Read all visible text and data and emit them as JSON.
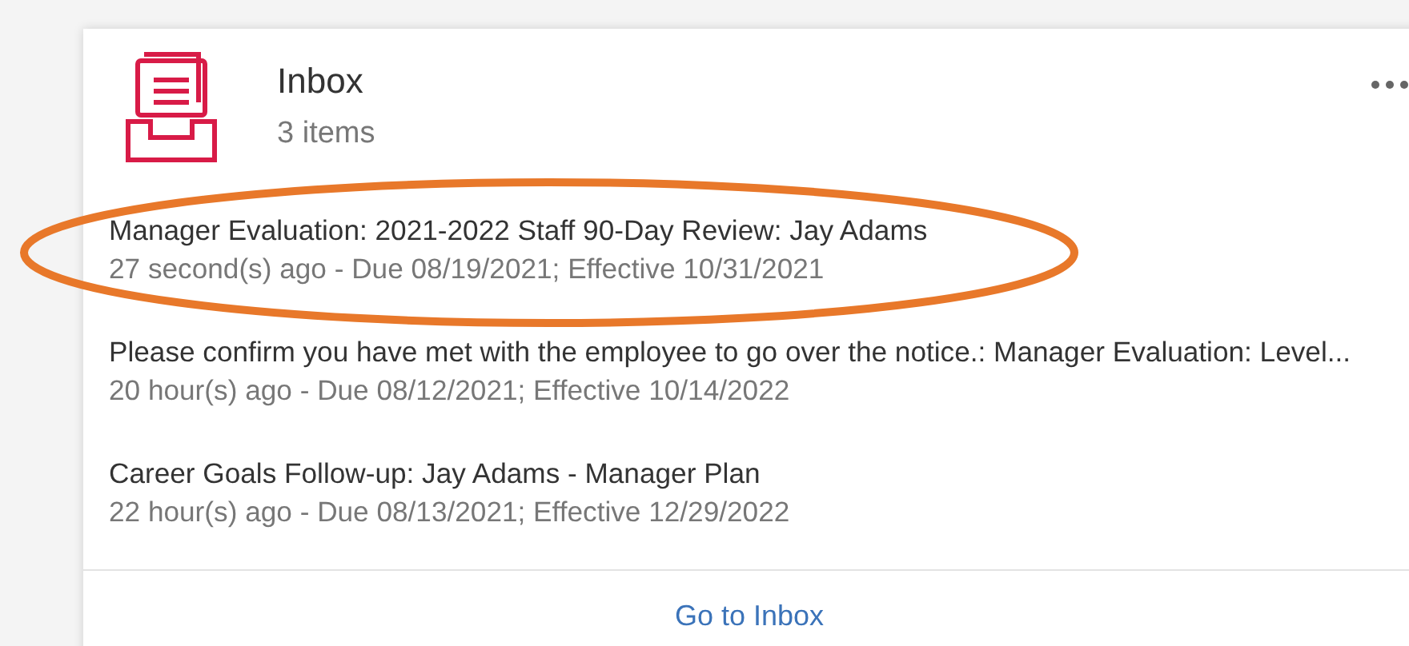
{
  "header": {
    "title": "Inbox",
    "count": "3 items"
  },
  "items": [
    {
      "title": "Manager Evaluation: 2021-2022 Staff 90-Day Review: Jay Adams",
      "meta": "27 second(s) ago - Due 08/19/2021; Effective 10/31/2021",
      "highlighted": true
    },
    {
      "title": "Please confirm you have met with the employee to go over the notice.: Manager Evaluation: Level...",
      "meta": "20 hour(s) ago - Due 08/12/2021; Effective 10/14/2022",
      "highlighted": false
    },
    {
      "title": "Career Goals Follow-up: Jay Adams - Manager Plan",
      "meta": "22 hour(s) ago - Due 08/13/2021; Effective 12/29/2022",
      "highlighted": false
    }
  ],
  "footer": {
    "link": "Go to Inbox"
  }
}
